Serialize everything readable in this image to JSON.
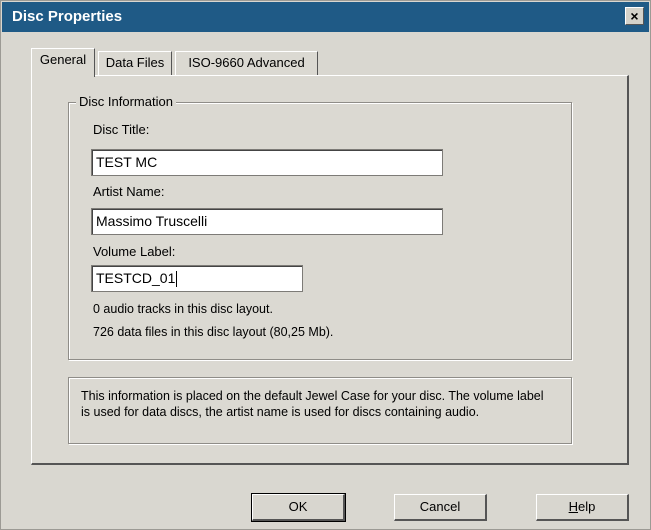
{
  "window": {
    "title": "Disc Properties",
    "close_glyph": "×"
  },
  "tabs": [
    {
      "label": "General",
      "active": true
    },
    {
      "label": "Data Files",
      "active": false
    },
    {
      "label": "ISO-9660 Advanced",
      "active": false
    }
  ],
  "disc_info": {
    "group_label": "Disc Information",
    "disc_title_label": "Disc Title:",
    "disc_title_value": "TEST MC",
    "artist_label": "Artist Name:",
    "artist_value": "Massimo Truscelli",
    "volume_label": "Volume Label:",
    "volume_value": "TESTCD_01",
    "audio_tracks_text": "0 audio tracks in this disc layout.",
    "data_files_text": "726 data files in this disc layout (80,25 Mb)."
  },
  "note_text": "This information is placed on the default Jewel Case for your disc.  The volume label is used for data discs, the artist name is used for discs containing audio.",
  "buttons": {
    "ok": "OK",
    "cancel": "Cancel",
    "help_first": "H",
    "help_rest": "elp"
  }
}
